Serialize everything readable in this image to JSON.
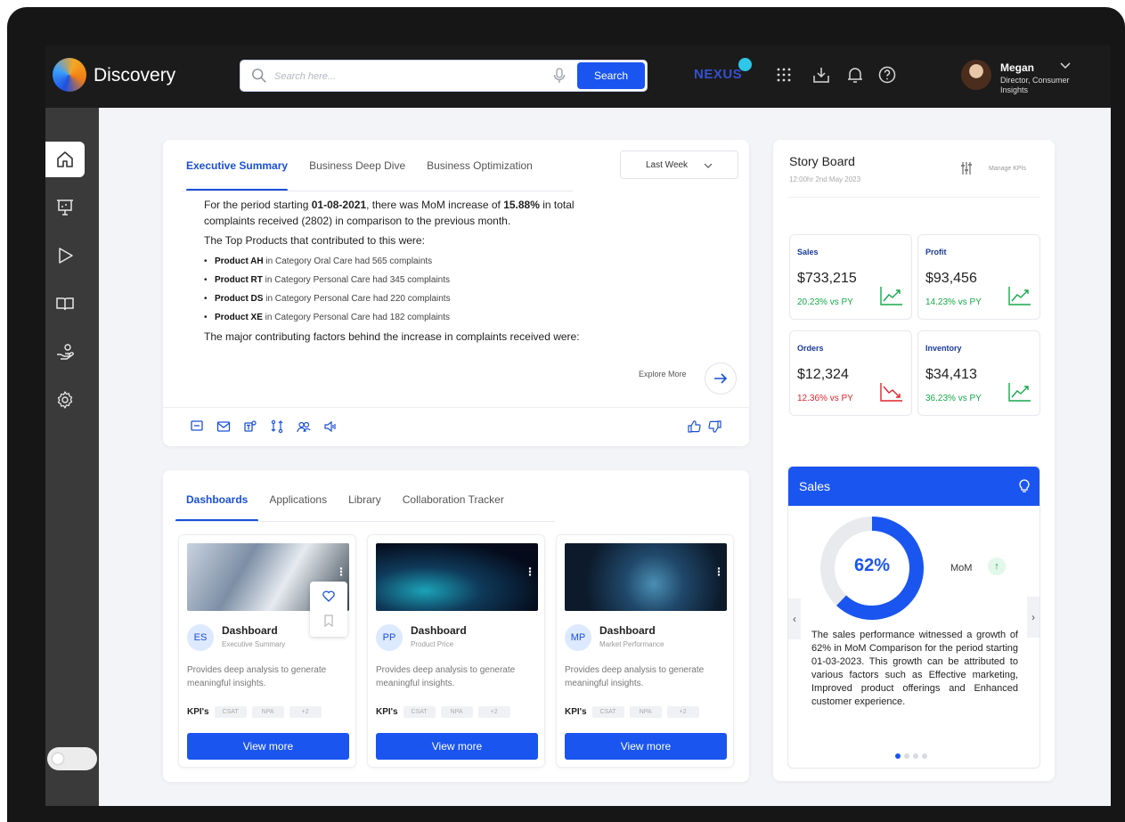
{
  "app": {
    "title": "Discovery"
  },
  "search": {
    "placeholder": "Search here...",
    "button_label": "Search"
  },
  "header": {
    "brand": "NEXUS"
  },
  "user": {
    "name": "Megan",
    "role": "Director, Consumer Insights"
  },
  "sidebar": {
    "items": [
      {
        "icon": "home-icon",
        "active": true
      },
      {
        "icon": "presentation-icon",
        "active": false
      },
      {
        "icon": "play-icon",
        "active": false
      },
      {
        "icon": "book-icon",
        "active": false
      },
      {
        "icon": "hand-coins-icon",
        "active": false
      },
      {
        "icon": "gear-icon",
        "active": false
      }
    ]
  },
  "executive": {
    "tabs": [
      "Executive Summary",
      "Business Deep Dive",
      "Business Optimization"
    ],
    "active_tab": 0,
    "period": "Last Week",
    "para_pre": "For the period starting ",
    "para_date": "01-08-2021",
    "para_mid": ", there was MoM increase of ",
    "para_pct": "15.88%",
    "para_post": " in total complaints received (2802) in comparison to the previous month.",
    "top_products_heading": "The Top Products that contributed to this were:",
    "products": [
      {
        "name": "Product AH",
        "text": " in Category Oral Care had 565 complaints"
      },
      {
        "name": "Product RT",
        "text": " in Category Personal Care had 345 complaints"
      },
      {
        "name": "Product DS",
        "text": " in Category Personal Care had 220 complaints"
      },
      {
        "name": "Product XE",
        "text": " in Category Personal Care had 182 complaints"
      }
    ],
    "factors_line": "The major contributing factors behind the increase in complaints received were:",
    "explore_label": "Explore More"
  },
  "dashboards": {
    "tabs": [
      "Dashboards",
      "Applications",
      "Library",
      "Collaboration Tracker"
    ],
    "active_tab": 0,
    "cards": [
      {
        "initials": "ES",
        "title": "Dashboard",
        "subtitle": "Executive Summary",
        "description": "Provides deep analysis to generate meaningful insights.",
        "kpi_label": "KPI's",
        "chips": [
          "CSAT",
          "NPA",
          "+2"
        ],
        "button": "View more"
      },
      {
        "initials": "PP",
        "title": "Dashboard",
        "subtitle": "Product Price",
        "description": "Provides deep analysis to generate meaningful insights.",
        "kpi_label": "KPI's",
        "chips": [
          "CSAT",
          "NPA",
          "+2"
        ],
        "button": "View more"
      },
      {
        "initials": "MP",
        "title": "Dashboard",
        "subtitle": "Market Performance",
        "description": "Provides deep analysis to generate meaningful insights.",
        "kpi_label": "KPI's",
        "chips": [
          "CSAT",
          "NPA",
          "+2"
        ],
        "button": "View more"
      }
    ]
  },
  "storyboard": {
    "title": "Story Board",
    "timestamp": "12:00hr  2nd May 2023",
    "manage_label": "Manage KPIs",
    "kpis": [
      {
        "name": "Sales",
        "value": "$733,215",
        "delta": "20.23% vs PY",
        "trend": "up"
      },
      {
        "name": "Profit",
        "value": "$93,456",
        "delta": "14.23% vs PY",
        "trend": "up"
      },
      {
        "name": "Orders",
        "value": "$12,324",
        "delta": "12.36% vs PY",
        "trend": "down"
      },
      {
        "name": "Inventory",
        "value": "$34,413",
        "delta": "36.23% vs PY",
        "trend": "up"
      }
    ],
    "sales": {
      "title": "Sales",
      "percent": 0.62,
      "percent_label": "62%",
      "mom_label": "MoM",
      "text": "The sales performance witnessed a growth of 62% in MoM Comparison for the period starting 01-03-2023. This growth can be attributed to various factors such as Effective marketing, Improved product offerings and Enhanced customer experience.",
      "page": 0,
      "pages": 4
    }
  },
  "colors": {
    "accent": "#1a55f0",
    "positive": "#17a84a",
    "negative": "#e0242f",
    "topbar": "#1b1b1c",
    "sidebar": "#3a3a3a"
  }
}
